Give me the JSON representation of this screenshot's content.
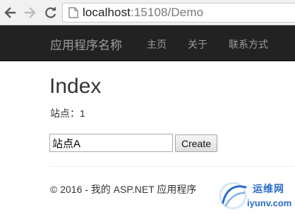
{
  "browser": {
    "url_host": "localhost",
    "url_rest": ":15108/Demo",
    "back_icon": "arrow-left-icon",
    "forward_icon": "arrow-right-icon",
    "reload_icon": "reload-icon",
    "page_icon": "page-icon"
  },
  "navbar": {
    "brand": "应用程序名称",
    "links": [
      {
        "label": "主页"
      },
      {
        "label": "关于"
      },
      {
        "label": "联系方式"
      }
    ],
    "background": "#222222",
    "link_color": "#9d9d9d"
  },
  "main": {
    "title": "Index",
    "site_label": "站点：1",
    "form": {
      "input_value": "站点A",
      "button_label": "Create"
    }
  },
  "footer": {
    "text": "© 2016 - 我的 ASP.NET 应用程序"
  },
  "watermark": {
    "cn": "运维网",
    "en": "iyunv.com",
    "color": "#2a6cc8"
  }
}
